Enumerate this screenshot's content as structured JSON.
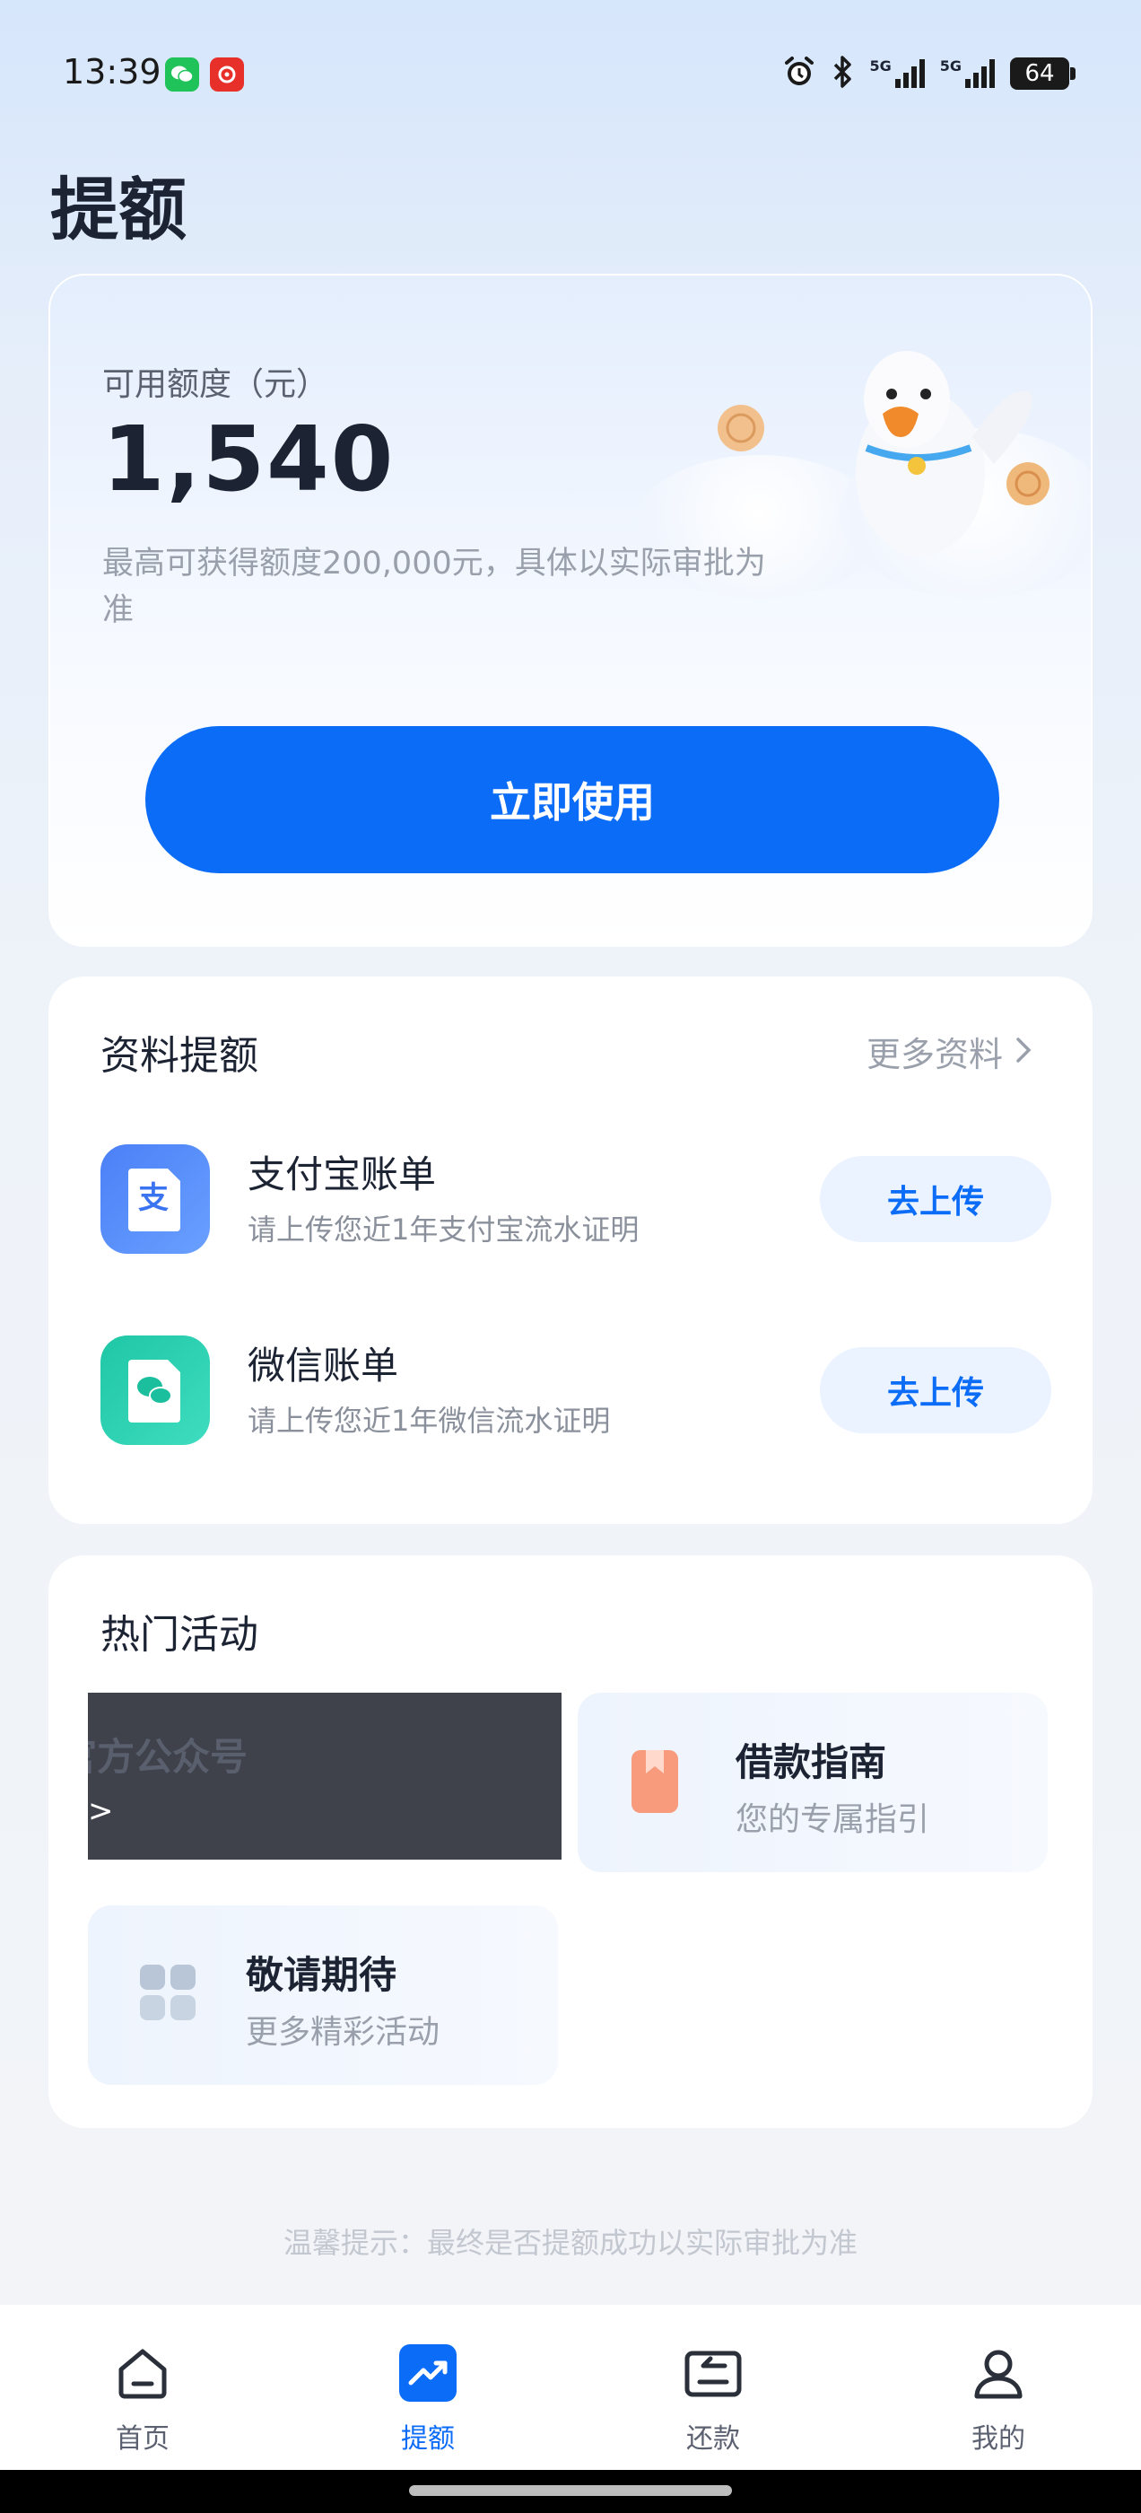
{
  "status_bar": {
    "time": "13:39",
    "battery": "64",
    "signal_1_label": "5G",
    "signal_2_label": "5G",
    "icons": [
      "wechat-icon",
      "netease-music-icon",
      "alarm-icon",
      "bluetooth-icon",
      "signal-icon",
      "signal-icon",
      "battery-icon"
    ]
  },
  "page_title": "提额",
  "quota_card": {
    "label": "可用额度（元）",
    "amount": "1,540",
    "description": "最高可获得额度200,000元，具体以实际审批为准",
    "button_label": "立即使用"
  },
  "materials": {
    "title": "资料提额",
    "more_label": "更多资料",
    "items": [
      {
        "icon": "alipay-doc-icon",
        "title": "支付宝账单",
        "subtitle": "请上传您近1年支付宝流水证明",
        "action": "去上传"
      },
      {
        "icon": "wechat-doc-icon",
        "title": "微信账单",
        "subtitle": "请上传您近1年微信流水证明",
        "action": "去上传"
      }
    ]
  },
  "activities": {
    "title": "热门活动",
    "tiles": [
      {
        "title": "官方公众号",
        "subtitle": ">"
      },
      {
        "icon": "bookmark-icon",
        "title": "借款指南",
        "subtitle": "您的专属指引"
      },
      {
        "icon": "grid-icon",
        "title": "敬请期待",
        "subtitle": "更多精彩活动"
      }
    ]
  },
  "tip": "温馨提示：最终是否提额成功以实际审批为准",
  "bottom_nav": {
    "items": [
      {
        "label": "首页",
        "icon": "home-icon",
        "active": false
      },
      {
        "label": "提额",
        "icon": "trend-up-icon",
        "active": true
      },
      {
        "label": "还款",
        "icon": "repay-icon",
        "active": false
      },
      {
        "label": "我的",
        "icon": "user-icon",
        "active": false
      }
    ]
  },
  "colors": {
    "accent": "#0b6cf7",
    "background": "#e6eefa"
  }
}
